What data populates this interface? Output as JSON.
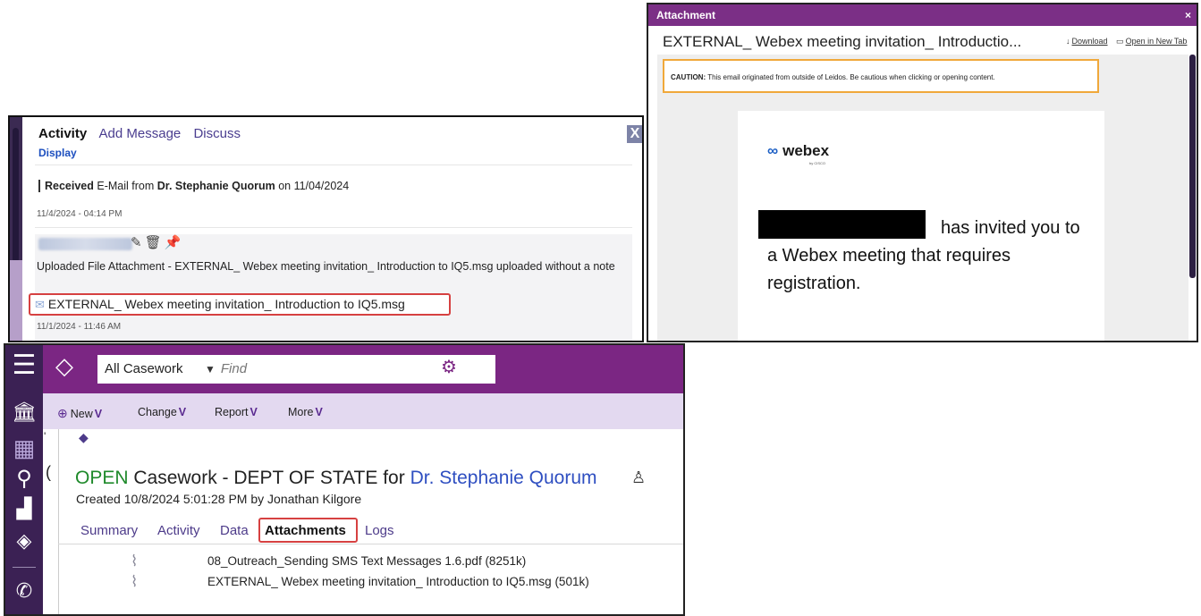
{
  "activity_panel": {
    "tabs": [
      "Activity",
      "Add Message",
      "Discuss"
    ],
    "close_label": "X",
    "display_label": "Display",
    "received": {
      "prefix": "Received",
      "middle": " E-Mail from ",
      "sender": "Dr. Stephanie Quorum",
      "suffix": " on 11/04/2024"
    },
    "received_timestamp": "11/4/2024 - 04:14 PM",
    "entry_text": "Uploaded File Attachment - EXTERNAL_ Webex meeting invitation_ Introduction to IQ5.msg uploaded without a note",
    "attachment_name": "EXTERNAL_ Webex meeting invitation_ Introduction to IQ5.msg",
    "entry_timestamp": "11/1/2024 - 11:46 AM"
  },
  "attachment_dialog": {
    "title": "Attachment",
    "close_label": "×",
    "subject": "EXTERNAL_ Webex meeting invitation_ Introductio...",
    "download_label": "Download",
    "open_new_tab_label": "Open in New Tab",
    "caution_bold": "CAUTION:",
    "caution_text": " This email originated from outside of Leidos. Be cautious when clicking or opening content.",
    "webex_wordmark": "webex",
    "webex_sub": "by CISCO",
    "invite_text": "has invited you to a Webex meeting that requires registration."
  },
  "casework": {
    "scope_label": "All Casework",
    "find_placeholder": "Find",
    "toolbar": {
      "new_label": "New",
      "change_label": "Change",
      "report_label": "Report",
      "more_label": "More"
    },
    "status": "OPEN",
    "title_middle": " Casework - DEPT OF STATE for ",
    "person": "Dr. Stephanie Quorum",
    "created": "Created 10/8/2024 5:01:28 PM by Jonathan Kilgore",
    "tabs": [
      "Summary",
      "Activity",
      "Data",
      "Attachments",
      "Logs"
    ],
    "files": [
      "08_Outreach_Sending SMS Text Messages 1.6.pdf (8251k)",
      "EXTERNAL_ Webex meeting invitation_ Introduction to IQ5.msg (501k)"
    ]
  },
  "colors": {
    "brand_purple": "#7b2683",
    "rail_purple": "#3b2154",
    "highlight_red": "#d64141",
    "open_green": "#1f8a2b",
    "link_blue": "#2f4fc1"
  }
}
